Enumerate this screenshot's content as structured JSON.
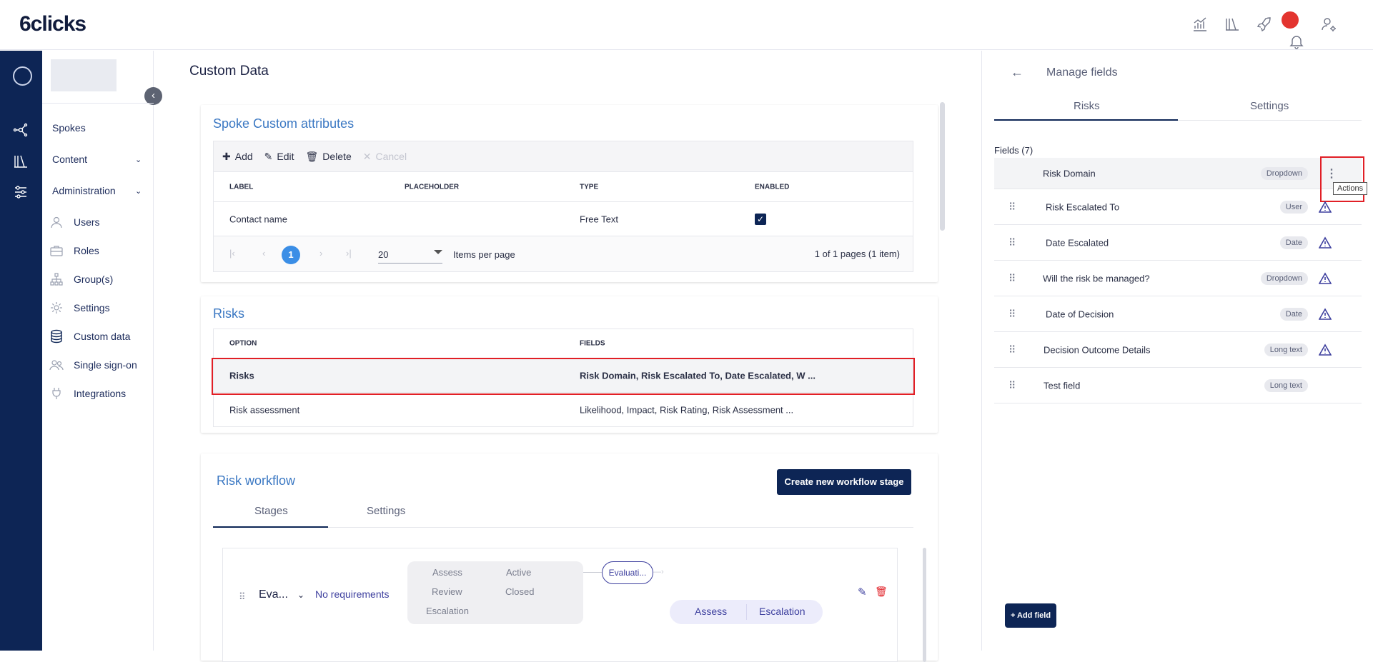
{
  "app": {
    "logo": "6clicks"
  },
  "top_icons": [
    "analytics-icon",
    "library-icon",
    "rocket-icon",
    "bell-icon",
    "user-settings-icon"
  ],
  "sidebar": {
    "items": [
      {
        "label": "Spokes"
      },
      {
        "label": "Content"
      },
      {
        "label": "Administration"
      }
    ],
    "sub_items": [
      {
        "label": "Users"
      },
      {
        "label": "Roles"
      },
      {
        "label": "Group(s)"
      },
      {
        "label": "Settings"
      },
      {
        "label": "Custom data"
      },
      {
        "label": "Single sign-on"
      },
      {
        "label": "Integrations"
      }
    ]
  },
  "main": {
    "title": "Custom Data",
    "spoke_card": {
      "title": "Spoke Custom attributes",
      "toolbar": {
        "add": "Add",
        "edit": "Edit",
        "delete": "Delete",
        "cancel": "Cancel"
      },
      "columns": [
        "LABEL",
        "PLACEHOLDER",
        "TYPE",
        "ENABLED"
      ],
      "rows": [
        {
          "label": "Contact name",
          "placeholder": "",
          "type": "Free Text",
          "enabled": true
        }
      ],
      "pager": {
        "current_page": "1",
        "page_size": "20",
        "items_per_page_label": "Items per page",
        "summary": "1 of 1 pages (1 item)"
      }
    },
    "risks_card": {
      "title": "Risks",
      "columns": [
        "OPTION",
        "FIELDS"
      ],
      "rows": [
        {
          "option": "Risks",
          "fields": "Risk Domain, Risk Escalated To, Date Escalated, W ..."
        },
        {
          "option": "Risk assessment",
          "fields": "Likelihood, Impact, Risk Rating, Risk Assessment ..."
        }
      ]
    },
    "workflow_card": {
      "title": "Risk workflow",
      "create_button": "Create new workflow stage",
      "tabs": [
        "Stages",
        "Settings"
      ],
      "stage": {
        "name": "Eva...",
        "requirements": "No requirements",
        "statuses": [
          "Assess",
          "Active",
          "Review",
          "Closed",
          "Escalation"
        ],
        "next_stage": "Evaluati...",
        "transitions": [
          "Assess",
          "Escalation"
        ]
      }
    }
  },
  "right_panel": {
    "title": "Manage fields",
    "tabs": [
      "Risks",
      "Settings"
    ],
    "fields_label": "Fields (7)",
    "tooltip": "Actions",
    "add_field_button": "+ Add field",
    "fields": [
      {
        "name": "Risk Domain",
        "type": "Dropdown",
        "warn": false
      },
      {
        "name": "Risk Escalated To",
        "type": "User",
        "warn": true
      },
      {
        "name": "Date Escalated",
        "type": "Date",
        "warn": true
      },
      {
        "name": "Will the risk be managed?",
        "type": "Dropdown",
        "warn": true
      },
      {
        "name": "Date of Decision",
        "type": "Date",
        "warn": true
      },
      {
        "name": "Decision Outcome Details",
        "type": "Long text",
        "warn": true
      },
      {
        "name": "Test field",
        "type": "Long text",
        "warn": false
      }
    ]
  },
  "colors": {
    "navy": "#0d2555",
    "accent_blue": "#3b78c3",
    "highlight_red": "#e11f26",
    "warn_purple": "#3d3f9e"
  }
}
